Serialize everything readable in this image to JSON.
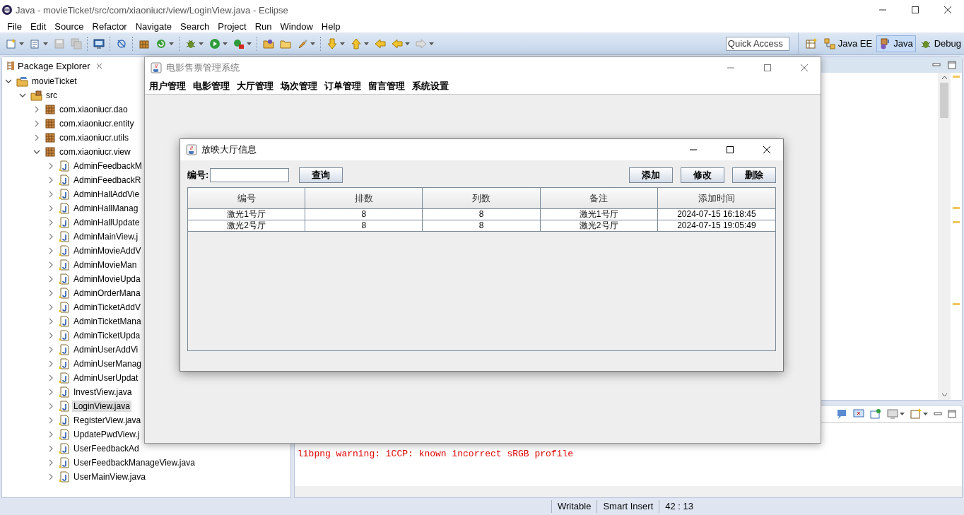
{
  "window": {
    "title": "Java - movieTicket/src/com/xiaoniucr/view/LoginView.java - Eclipse"
  },
  "menu": [
    "File",
    "Edit",
    "Source",
    "Refactor",
    "Navigate",
    "Search",
    "Project",
    "Run",
    "Window",
    "Help"
  ],
  "toolbar": {
    "quick_access": {
      "placeholder": "Quick Access"
    },
    "perspectives": [
      {
        "label": "Java EE",
        "selected": false
      },
      {
        "label": "Java",
        "selected": true
      },
      {
        "label": "Debug",
        "selected": false
      }
    ]
  },
  "package_explorer": {
    "title": "Package Explorer",
    "tree": [
      {
        "label": "movieTicket",
        "kind": "project",
        "expanded": true,
        "selected": false,
        "children": [
          {
            "label": "src",
            "kind": "folder",
            "expanded": true,
            "selected": false,
            "children": [
              {
                "label": "com.xiaoniucr.dao",
                "kind": "package",
                "expanded": false,
                "selected": false
              },
              {
                "label": "com.xiaoniucr.entity",
                "kind": "package",
                "expanded": false,
                "selected": false
              },
              {
                "label": "com.xiaoniucr.utils",
                "kind": "package",
                "expanded": false,
                "selected": false
              },
              {
                "label": "com.xiaoniucr.view",
                "kind": "package",
                "expanded": true,
                "selected": false,
                "children": [
                  {
                    "label": "AdminFeedbackM",
                    "kind": "file",
                    "expanded": false,
                    "selected": false
                  },
                  {
                    "label": "AdminFeedbackR",
                    "kind": "file",
                    "expanded": false,
                    "selected": false
                  },
                  {
                    "label": "AdminHallAddVie",
                    "kind": "file",
                    "expanded": false,
                    "selected": false
                  },
                  {
                    "label": "AdminHallManag",
                    "kind": "file",
                    "expanded": false,
                    "selected": false
                  },
                  {
                    "label": "AdminHallUpdate",
                    "kind": "file",
                    "expanded": false,
                    "selected": false
                  },
                  {
                    "label": "AdminMainView.j",
                    "kind": "file",
                    "expanded": false,
                    "selected": false
                  },
                  {
                    "label": "AdminMovieAddV",
                    "kind": "file",
                    "expanded": false,
                    "selected": false
                  },
                  {
                    "label": "AdminMovieMan",
                    "kind": "file",
                    "expanded": false,
                    "selected": false
                  },
                  {
                    "label": "AdminMovieUpda",
                    "kind": "file",
                    "expanded": false,
                    "selected": false
                  },
                  {
                    "label": "AdminOrderMana",
                    "kind": "file",
                    "expanded": false,
                    "selected": false
                  },
                  {
                    "label": "AdminTicketAddV",
                    "kind": "file",
                    "expanded": false,
                    "selected": false
                  },
                  {
                    "label": "AdminTicketMana",
                    "kind": "file",
                    "expanded": false,
                    "selected": false
                  },
                  {
                    "label": "AdminTicketUpda",
                    "kind": "file",
                    "expanded": false,
                    "selected": false
                  },
                  {
                    "label": "AdminUserAddVi",
                    "kind": "file",
                    "expanded": false,
                    "selected": false
                  },
                  {
                    "label": "AdminUserManag",
                    "kind": "file",
                    "expanded": false,
                    "selected": false
                  },
                  {
                    "label": "AdminUserUpdat",
                    "kind": "file",
                    "expanded": false,
                    "selected": false
                  },
                  {
                    "label": "InvestView.java",
                    "kind": "file",
                    "expanded": false,
                    "selected": false
                  },
                  {
                    "label": "LoginView.java",
                    "kind": "file",
                    "expanded": false,
                    "selected": true
                  },
                  {
                    "label": "RegisterView.java",
                    "kind": "file",
                    "expanded": false,
                    "selected": false
                  },
                  {
                    "label": "UpdatePwdView.j",
                    "kind": "file",
                    "expanded": false,
                    "selected": false
                  },
                  {
                    "label": "UserFeedbackAd",
                    "kind": "file",
                    "expanded": false,
                    "selected": false
                  },
                  {
                    "label": "UserFeedbackManageView.java",
                    "kind": "file",
                    "expanded": false,
                    "selected": false
                  },
                  {
                    "label": "UserMainView.java",
                    "kind": "file",
                    "expanded": false,
                    "selected": false
                  }
                ]
              }
            ]
          }
        ]
      }
    ]
  },
  "console": {
    "lines": [
      "libpng warning: iCCP: known incorrect sRGB profile"
    ]
  },
  "status_bar": [
    "Writable",
    "Smart Insert",
    "42 : 13"
  ],
  "app_window": {
    "title": "电影售票管理系统",
    "menu": [
      "用户管理",
      "电影管理",
      "大厅管理",
      "场次管理",
      "订单管理",
      "留言管理",
      "系统设置"
    ],
    "dialog": {
      "title": "放映大厅信息",
      "search_label": "编号:",
      "search_button": "查询",
      "actions": [
        "添加",
        "修改",
        "删除"
      ],
      "table": {
        "columns": [
          "编号",
          "排数",
          "列数",
          "备注",
          "添加时间"
        ],
        "rows": [
          [
            "激光1号厅",
            "8",
            "8",
            "激光1号厅",
            "2024-07-15 16:18:45"
          ],
          [
            "激光2号厅",
            "8",
            "8",
            "激光2号厅",
            "2024-07-15 19:05:49"
          ]
        ]
      }
    }
  }
}
